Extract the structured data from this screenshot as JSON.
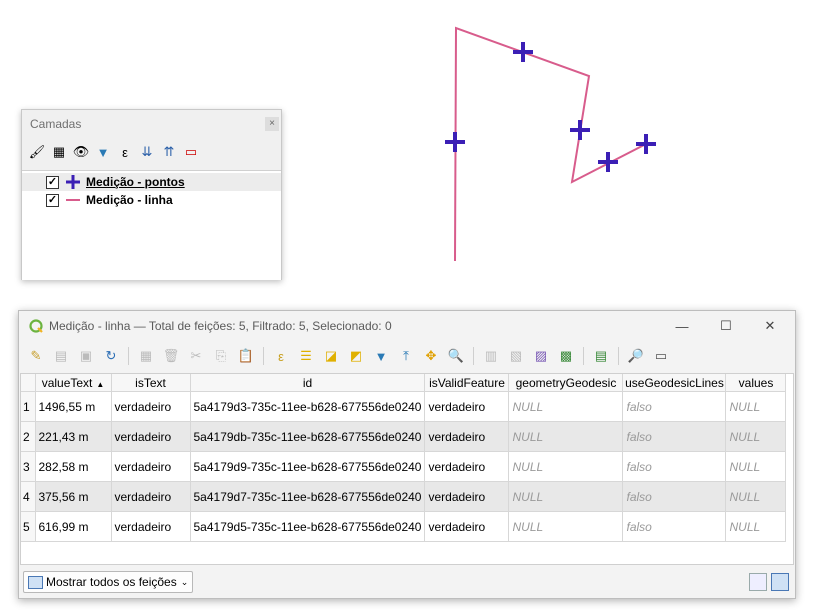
{
  "layers_panel": {
    "title": "Camadas",
    "close_glyph": "×",
    "toolbar_icons": [
      "style-icon",
      "add-group-icon",
      "visibility-icon",
      "filter-icon",
      "expression-filter-icon",
      "expand-all-icon",
      "collapse-all-icon",
      "remove-layer-icon"
    ],
    "layers": [
      {
        "name": "Medição - pontos",
        "checked": true,
        "symbol": "cross-icon",
        "symbol_color": "#3b1fb5"
      },
      {
        "name": "Medição - linha",
        "checked": true,
        "symbol": "line-icon",
        "symbol_color": "#d85c8c"
      }
    ]
  },
  "attribute_table": {
    "title": "Medição - linha — Total de feições: 5, Filtrado: 5, Selecionado: 0",
    "window_controls": {
      "minimize": "—",
      "maximize": "☐",
      "close": "✕"
    },
    "columns": [
      "valueText",
      "isText",
      "id",
      "isValidFeature",
      "geometryGeodesic",
      "useGeodesicLines",
      "values"
    ],
    "sorted_column": "valueText",
    "rows": [
      {
        "n": "1",
        "valueText": "1496,55 m",
        "isText": "verdadeiro",
        "id": "5a4179d3-735c-11ee-b628-677556de0240",
        "isValidFeature": "verdadeiro",
        "geometryGeodesic": "NULL",
        "useGeodesicLines": "falso",
        "values": "NULL"
      },
      {
        "n": "2",
        "valueText": "221,43 m",
        "isText": "verdadeiro",
        "id": "5a4179db-735c-11ee-b628-677556de0240",
        "isValidFeature": "verdadeiro",
        "geometryGeodesic": "NULL",
        "useGeodesicLines": "falso",
        "values": "NULL"
      },
      {
        "n": "3",
        "valueText": "282,58 m",
        "isText": "verdadeiro",
        "id": "5a4179d9-735c-11ee-b628-677556de0240",
        "isValidFeature": "verdadeiro",
        "geometryGeodesic": "NULL",
        "useGeodesicLines": "falso",
        "values": "NULL"
      },
      {
        "n": "4",
        "valueText": "375,56 m",
        "isText": "verdadeiro",
        "id": "5a4179d7-735c-11ee-b628-677556de0240",
        "isValidFeature": "verdadeiro",
        "geometryGeodesic": "NULL",
        "useGeodesicLines": "falso",
        "values": "NULL"
      },
      {
        "n": "5",
        "valueText": "616,99 m",
        "isText": "verdadeiro",
        "id": "5a4179d5-735c-11ee-b628-677556de0240",
        "isValidFeature": "verdadeiro",
        "geometryGeodesic": "NULL",
        "useGeodesicLines": "falso",
        "values": "NULL"
      }
    ],
    "footer": {
      "show_features_label": "Mostrar todos os feições"
    }
  },
  "map": {
    "line_color": "#d85c8c",
    "point_color": "#3b1fb5"
  }
}
